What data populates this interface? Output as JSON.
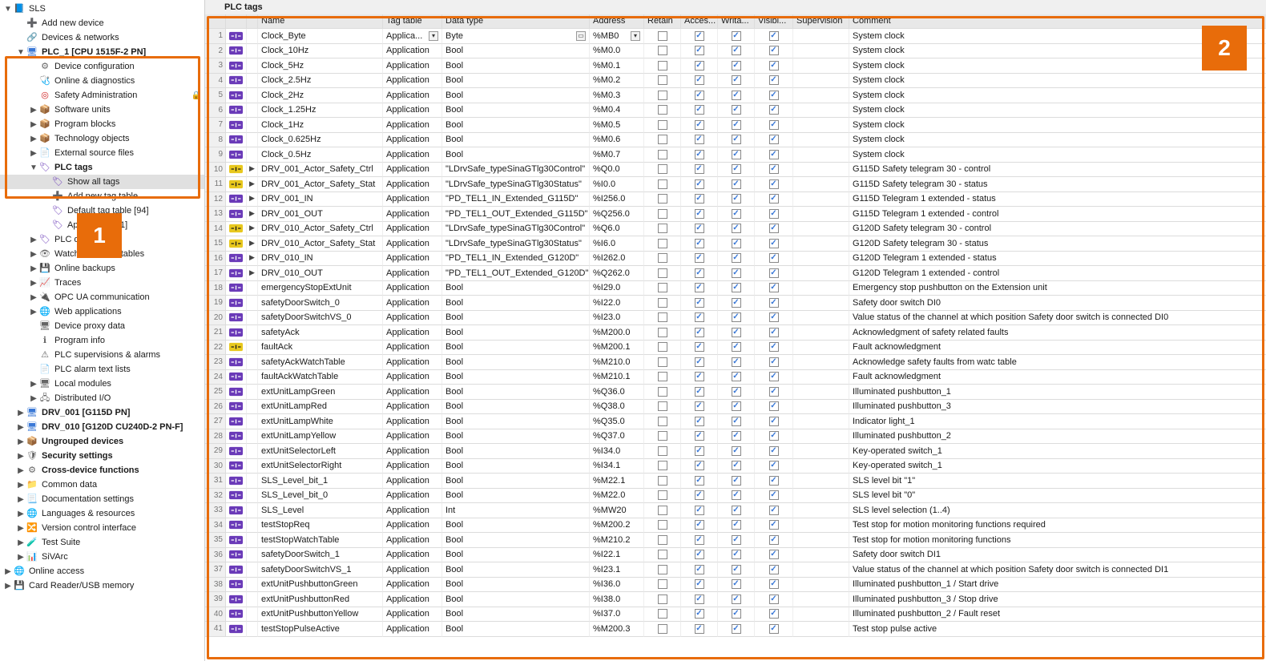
{
  "tab_title": "PLC tags",
  "callouts": {
    "1": "1",
    "2": "2"
  },
  "columns": [
    "",
    "",
    "",
    "Name",
    "Tag table",
    "Data type",
    "Address",
    "Retain",
    "Acces...",
    "Writa...",
    "Visibl...",
    "Supervision",
    "Comment"
  ],
  "tree": [
    {
      "d": 0,
      "tw": "▼",
      "ic": "📘",
      "cls": "i-folderblue",
      "t": "SLS"
    },
    {
      "d": 1,
      "tw": "",
      "ic": "➕",
      "cls": "i-gear",
      "t": "Add new device"
    },
    {
      "d": 1,
      "tw": "",
      "ic": "🔗",
      "cls": "i-gear",
      "t": "Devices & networks"
    },
    {
      "d": 1,
      "tw": "▼",
      "ic": "🖥",
      "cls": "i-cpu",
      "t": "PLC_1 [CPU 1515F-2 PN]",
      "bold": true
    },
    {
      "d": 2,
      "tw": "",
      "ic": "⚙",
      "cls": "i-gear",
      "t": "Device configuration"
    },
    {
      "d": 2,
      "tw": "",
      "ic": "🩺",
      "cls": "i-gear",
      "t": "Online & diagnostics"
    },
    {
      "d": 2,
      "tw": "",
      "ic": "◎",
      "cls": "i-red",
      "t": "Safety Administration",
      "lock": true
    },
    {
      "d": 2,
      "tw": "▶",
      "ic": "📦",
      "cls": "i-folder",
      "t": "Software units"
    },
    {
      "d": 2,
      "tw": "▶",
      "ic": "📦",
      "cls": "i-folder",
      "t": "Program blocks"
    },
    {
      "d": 2,
      "tw": "▶",
      "ic": "📦",
      "cls": "i-folder",
      "t": "Technology objects"
    },
    {
      "d": 2,
      "tw": "▶",
      "ic": "📄",
      "cls": "i-gear",
      "t": "External source files"
    },
    {
      "d": 2,
      "tw": "▼",
      "ic": "🏷",
      "cls": "i-tags",
      "t": "PLC tags",
      "bold": true
    },
    {
      "d": 3,
      "tw": "",
      "ic": "🏷",
      "cls": "i-tags",
      "t": "Show all tags",
      "sel": true
    },
    {
      "d": 3,
      "tw": "",
      "ic": "➕",
      "cls": "i-gear",
      "t": "Add new tag table"
    },
    {
      "d": 3,
      "tw": "",
      "ic": "🏷",
      "cls": "i-tags",
      "t": "Default tag table [94]"
    },
    {
      "d": 3,
      "tw": "",
      "ic": "🏷",
      "cls": "i-tags",
      "t": "Application [41]"
    },
    {
      "d": 2,
      "tw": "▶",
      "ic": "🏷",
      "cls": "i-tags",
      "t": "PLC data types"
    },
    {
      "d": 2,
      "tw": "▶",
      "ic": "👁",
      "cls": "i-gear",
      "t": "Watch and force tables"
    },
    {
      "d": 2,
      "tw": "▶",
      "ic": "💾",
      "cls": "i-gear",
      "t": "Online backups"
    },
    {
      "d": 2,
      "tw": "▶",
      "ic": "📈",
      "cls": "i-gear",
      "t": "Traces"
    },
    {
      "d": 2,
      "tw": "▶",
      "ic": "🔌",
      "cls": "i-gear",
      "t": "OPC UA communication"
    },
    {
      "d": 2,
      "tw": "▶",
      "ic": "🌐",
      "cls": "i-gear",
      "t": "Web applications"
    },
    {
      "d": 2,
      "tw": "",
      "ic": "🖥",
      "cls": "i-gear",
      "t": "Device proxy data"
    },
    {
      "d": 2,
      "tw": "",
      "ic": "ℹ",
      "cls": "i-gear",
      "t": "Program info"
    },
    {
      "d": 2,
      "tw": "",
      "ic": "⚠",
      "cls": "i-gear",
      "t": "PLC supervisions & alarms"
    },
    {
      "d": 2,
      "tw": "",
      "ic": "📄",
      "cls": "i-gear",
      "t": "PLC alarm text lists"
    },
    {
      "d": 2,
      "tw": "▶",
      "ic": "🖥",
      "cls": "i-gear",
      "t": "Local modules"
    },
    {
      "d": 2,
      "tw": "▶",
      "ic": "🖧",
      "cls": "i-gear",
      "t": "Distributed I/O"
    },
    {
      "d": 1,
      "tw": "▶",
      "ic": "🖥",
      "cls": "i-cpu",
      "t": "DRV_001 [G115D PN]",
      "bold": true
    },
    {
      "d": 1,
      "tw": "▶",
      "ic": "🖥",
      "cls": "i-cpu",
      "t": "DRV_010 [G120D CU240D-2 PN-F]",
      "bold": true
    },
    {
      "d": 1,
      "tw": "▶",
      "ic": "📦",
      "cls": "i-folder",
      "t": "Ungrouped devices",
      "bold": true
    },
    {
      "d": 1,
      "tw": "▶",
      "ic": "🛡",
      "cls": "i-gear",
      "t": "Security settings",
      "bold": true
    },
    {
      "d": 1,
      "tw": "▶",
      "ic": "⚙",
      "cls": "i-gear",
      "t": "Cross-device functions",
      "bold": true
    },
    {
      "d": 1,
      "tw": "▶",
      "ic": "📁",
      "cls": "i-folder",
      "t": "Common data"
    },
    {
      "d": 1,
      "tw": "▶",
      "ic": "📃",
      "cls": "i-gear",
      "t": "Documentation settings"
    },
    {
      "d": 1,
      "tw": "▶",
      "ic": "🌐",
      "cls": "i-gear",
      "t": "Languages & resources"
    },
    {
      "d": 1,
      "tw": "▶",
      "ic": "🔀",
      "cls": "i-gear",
      "t": "Version control interface"
    },
    {
      "d": 1,
      "tw": "▶",
      "ic": "🧪",
      "cls": "i-gear",
      "t": "Test Suite"
    },
    {
      "d": 1,
      "tw": "▶",
      "ic": "📊",
      "cls": "i-gear",
      "t": "SiVArc"
    },
    {
      "d": 0,
      "tw": "▶",
      "ic": "🌐",
      "cls": "i-green",
      "t": "Online access"
    },
    {
      "d": 0,
      "tw": "▶",
      "ic": "💾",
      "cls": "i-gear",
      "t": "Card Reader/USB memory"
    }
  ],
  "rows": [
    {
      "n": 1,
      "tag": "p",
      "exp": "",
      "name": "Clock_Byte",
      "tt": "Applica...",
      "dt": "Byte",
      "addr": "%MB0",
      "r": 0,
      "a": 1,
      "w": 1,
      "v": 1,
      "c": "System clock",
      "sel": true,
      "dd": true
    },
    {
      "n": 2,
      "tag": "p",
      "exp": "",
      "name": "Clock_10Hz",
      "tt": "Application",
      "dt": "Bool",
      "addr": "%M0.0",
      "r": 0,
      "a": 1,
      "w": 1,
      "v": 1,
      "c": "System clock"
    },
    {
      "n": 3,
      "tag": "p",
      "exp": "",
      "name": "Clock_5Hz",
      "tt": "Application",
      "dt": "Bool",
      "addr": "%M0.1",
      "r": 0,
      "a": 1,
      "w": 1,
      "v": 1,
      "c": "System clock"
    },
    {
      "n": 4,
      "tag": "p",
      "exp": "",
      "name": "Clock_2.5Hz",
      "tt": "Application",
      "dt": "Bool",
      "addr": "%M0.2",
      "r": 0,
      "a": 1,
      "w": 1,
      "v": 1,
      "c": "System clock"
    },
    {
      "n": 5,
      "tag": "p",
      "exp": "",
      "name": "Clock_2Hz",
      "tt": "Application",
      "dt": "Bool",
      "addr": "%M0.3",
      "r": 0,
      "a": 1,
      "w": 1,
      "v": 1,
      "c": "System clock"
    },
    {
      "n": 6,
      "tag": "p",
      "exp": "",
      "name": "Clock_1.25Hz",
      "tt": "Application",
      "dt": "Bool",
      "addr": "%M0.4",
      "r": 0,
      "a": 1,
      "w": 1,
      "v": 1,
      "c": "System clock"
    },
    {
      "n": 7,
      "tag": "p",
      "exp": "",
      "name": "Clock_1Hz",
      "tt": "Application",
      "dt": "Bool",
      "addr": "%M0.5",
      "r": 0,
      "a": 1,
      "w": 1,
      "v": 1,
      "c": "System clock"
    },
    {
      "n": 8,
      "tag": "p",
      "exp": "",
      "name": "Clock_0.625Hz",
      "tt": "Application",
      "dt": "Bool",
      "addr": "%M0.6",
      "r": 0,
      "a": 1,
      "w": 1,
      "v": 1,
      "c": "System clock"
    },
    {
      "n": 9,
      "tag": "p",
      "exp": "",
      "name": "Clock_0.5Hz",
      "tt": "Application",
      "dt": "Bool",
      "addr": "%M0.7",
      "r": 0,
      "a": 1,
      "w": 1,
      "v": 1,
      "c": "System clock"
    },
    {
      "n": 10,
      "tag": "y",
      "exp": "▶",
      "name": "DRV_001_Actor_Safety_Ctrl",
      "tt": "Application",
      "dt": "\"LDrvSafe_typeSinaGTlg30Control\"",
      "addr": "%Q0.0",
      "r": 0,
      "a": 1,
      "w": 1,
      "v": 1,
      "c": "G115D Safety telegram 30 - control"
    },
    {
      "n": 11,
      "tag": "y",
      "exp": "▶",
      "name": "DRV_001_Actor_Safety_Stat",
      "tt": "Application",
      "dt": "\"LDrvSafe_typeSinaGTlg30Status\"",
      "addr": "%I0.0",
      "r": 0,
      "a": 1,
      "w": 1,
      "v": 1,
      "c": "G115D Safety telegram 30 - status"
    },
    {
      "n": 12,
      "tag": "p",
      "exp": "▶",
      "name": "DRV_001_IN",
      "tt": "Application",
      "dt": "\"PD_TEL1_IN_Extended_G115D\"",
      "addr": "%I256.0",
      "r": 0,
      "a": 1,
      "w": 1,
      "v": 1,
      "c": "G115D Telegram 1 extended - status"
    },
    {
      "n": 13,
      "tag": "p",
      "exp": "▶",
      "name": "DRV_001_OUT",
      "tt": "Application",
      "dt": "\"PD_TEL1_OUT_Extended_G115D\"",
      "addr": "%Q256.0",
      "r": 0,
      "a": 1,
      "w": 1,
      "v": 1,
      "c": "G115D Telegram 1 extended - control"
    },
    {
      "n": 14,
      "tag": "y",
      "exp": "▶",
      "name": "DRV_010_Actor_Safety_Ctrl",
      "tt": "Application",
      "dt": "\"LDrvSafe_typeSinaGTlg30Control\"",
      "addr": "%Q6.0",
      "r": 0,
      "a": 1,
      "w": 1,
      "v": 1,
      "c": "G120D Safety telegram 30 - control"
    },
    {
      "n": 15,
      "tag": "y",
      "exp": "▶",
      "name": "DRV_010_Actor_Safety_Stat",
      "tt": "Application",
      "dt": "\"LDrvSafe_typeSinaGTlg30Status\"",
      "addr": "%I6.0",
      "r": 0,
      "a": 1,
      "w": 1,
      "v": 1,
      "c": "G120D Safety telegram 30 - status"
    },
    {
      "n": 16,
      "tag": "p",
      "exp": "▶",
      "name": "DRV_010_IN",
      "tt": "Application",
      "dt": "\"PD_TEL1_IN_Extended_G120D\"",
      "addr": "%I262.0",
      "r": 0,
      "a": 1,
      "w": 1,
      "v": 1,
      "c": "G120D Telegram 1 extended - status"
    },
    {
      "n": 17,
      "tag": "p",
      "exp": "▶",
      "name": "DRV_010_OUT",
      "tt": "Application",
      "dt": "\"PD_TEL1_OUT_Extended_G120D\"",
      "addr": "%Q262.0",
      "r": 0,
      "a": 1,
      "w": 1,
      "v": 1,
      "c": "G120D Telegram 1 extended - control"
    },
    {
      "n": 18,
      "tag": "p",
      "exp": "",
      "name": "emergencyStopExtUnit",
      "tt": "Application",
      "dt": "Bool",
      "addr": "%I29.0",
      "r": 0,
      "a": 1,
      "w": 1,
      "v": 1,
      "c": "Emergency stop pushbutton on the Extension unit"
    },
    {
      "n": 19,
      "tag": "p",
      "exp": "",
      "name": "safetyDoorSwitch_0",
      "tt": "Application",
      "dt": "Bool",
      "addr": "%I22.0",
      "r": 0,
      "a": 1,
      "w": 1,
      "v": 1,
      "c": "Safety door switch DI0"
    },
    {
      "n": 20,
      "tag": "p",
      "exp": "",
      "name": "safetyDoorSwitchVS_0",
      "tt": "Application",
      "dt": "Bool",
      "addr": "%I23.0",
      "r": 0,
      "a": 1,
      "w": 1,
      "v": 1,
      "c": "Value status of the channel at which position Safety door switch is connected DI0"
    },
    {
      "n": 21,
      "tag": "p",
      "exp": "",
      "name": "safetyAck",
      "tt": "Application",
      "dt": "Bool",
      "addr": "%M200.0",
      "r": 0,
      "a": 1,
      "w": 1,
      "v": 1,
      "c": "Acknowledgment of safety related faults"
    },
    {
      "n": 22,
      "tag": "y",
      "exp": "",
      "name": "faultAck",
      "tt": "Application",
      "dt": "Bool",
      "addr": "%M200.1",
      "r": 0,
      "a": 1,
      "w": 1,
      "v": 1,
      "c": "Fault acknowledgment"
    },
    {
      "n": 23,
      "tag": "p",
      "exp": "",
      "name": "safetyAckWatchTable",
      "tt": "Application",
      "dt": "Bool",
      "addr": "%M210.0",
      "r": 0,
      "a": 1,
      "w": 1,
      "v": 1,
      "c": "Acknowledge safety faults from watc table"
    },
    {
      "n": 24,
      "tag": "p",
      "exp": "",
      "name": "faultAckWatchTable",
      "tt": "Application",
      "dt": "Bool",
      "addr": "%M210.1",
      "r": 0,
      "a": 1,
      "w": 1,
      "v": 1,
      "c": "Fault acknowledgment"
    },
    {
      "n": 25,
      "tag": "p",
      "exp": "",
      "name": "extUnitLampGreen",
      "tt": "Application",
      "dt": "Bool",
      "addr": "%Q36.0",
      "r": 0,
      "a": 1,
      "w": 1,
      "v": 1,
      "c": "Illuminated pushbutton_1"
    },
    {
      "n": 26,
      "tag": "p",
      "exp": "",
      "name": "extUnitLampRed",
      "tt": "Application",
      "dt": "Bool",
      "addr": "%Q38.0",
      "r": 0,
      "a": 1,
      "w": 1,
      "v": 1,
      "c": "Illuminated pushbutton_3"
    },
    {
      "n": 27,
      "tag": "p",
      "exp": "",
      "name": "extUnitLampWhite",
      "tt": "Application",
      "dt": "Bool",
      "addr": "%Q35.0",
      "r": 0,
      "a": 1,
      "w": 1,
      "v": 1,
      "c": "Indicator light_1"
    },
    {
      "n": 28,
      "tag": "p",
      "exp": "",
      "name": "extUnitLampYellow",
      "tt": "Application",
      "dt": "Bool",
      "addr": "%Q37.0",
      "r": 0,
      "a": 1,
      "w": 1,
      "v": 1,
      "c": "Illuminated pushbutton_2"
    },
    {
      "n": 29,
      "tag": "p",
      "exp": "",
      "name": "extUnitSelectorLeft",
      "tt": "Application",
      "dt": "Bool",
      "addr": "%I34.0",
      "r": 0,
      "a": 1,
      "w": 1,
      "v": 1,
      "c": "Key-operated switch_1"
    },
    {
      "n": 30,
      "tag": "p",
      "exp": "",
      "name": "extUnitSelectorRight",
      "tt": "Application",
      "dt": "Bool",
      "addr": "%I34.1",
      "r": 0,
      "a": 1,
      "w": 1,
      "v": 1,
      "c": "Key-operated switch_1"
    },
    {
      "n": 31,
      "tag": "p",
      "exp": "",
      "name": "SLS_Level_bit_1",
      "tt": "Application",
      "dt": "Bool",
      "addr": "%M22.1",
      "r": 0,
      "a": 1,
      "w": 1,
      "v": 1,
      "c": "SLS level bit \"1\""
    },
    {
      "n": 32,
      "tag": "p",
      "exp": "",
      "name": "SLS_Level_bit_0",
      "tt": "Application",
      "dt": "Bool",
      "addr": "%M22.0",
      "r": 0,
      "a": 1,
      "w": 1,
      "v": 1,
      "c": "SLS level bit \"0\""
    },
    {
      "n": 33,
      "tag": "p",
      "exp": "",
      "name": "SLS_Level",
      "tt": "Application",
      "dt": "Int",
      "addr": "%MW20",
      "r": 0,
      "a": 1,
      "w": 1,
      "v": 1,
      "c": "SLS level selection (1..4)"
    },
    {
      "n": 34,
      "tag": "p",
      "exp": "",
      "name": "testStopReq",
      "tt": "Application",
      "dt": "Bool",
      "addr": "%M200.2",
      "r": 0,
      "a": 1,
      "w": 1,
      "v": 1,
      "c": "Test stop for motion monitoring functions required"
    },
    {
      "n": 35,
      "tag": "p",
      "exp": "",
      "name": "testStopWatchTable",
      "tt": "Application",
      "dt": "Bool",
      "addr": "%M210.2",
      "r": 0,
      "a": 1,
      "w": 1,
      "v": 1,
      "c": "Test stop for motion monitoring functions"
    },
    {
      "n": 36,
      "tag": "p",
      "exp": "",
      "name": "safetyDoorSwitch_1",
      "tt": "Application",
      "dt": "Bool",
      "addr": "%I22.1",
      "r": 0,
      "a": 1,
      "w": 1,
      "v": 1,
      "c": "Safety door switch DI1"
    },
    {
      "n": 37,
      "tag": "p",
      "exp": "",
      "name": "safetyDoorSwitchVS_1",
      "tt": "Application",
      "dt": "Bool",
      "addr": "%I23.1",
      "r": 0,
      "a": 1,
      "w": 1,
      "v": 1,
      "c": "Value status of the channel at which position Safety door switch is connected DI1"
    },
    {
      "n": 38,
      "tag": "p",
      "exp": "",
      "name": "extUnitPushbuttonGreen",
      "tt": "Application",
      "dt": "Bool",
      "addr": "%I36.0",
      "r": 0,
      "a": 1,
      "w": 1,
      "v": 1,
      "c": "Illuminated pushbutton_1 / Start drive"
    },
    {
      "n": 39,
      "tag": "p",
      "exp": "",
      "name": "extUnitPushbuttonRed",
      "tt": "Application",
      "dt": "Bool",
      "addr": "%I38.0",
      "r": 0,
      "a": 1,
      "w": 1,
      "v": 1,
      "c": "Illuminated pushbutton_3 / Stop drive"
    },
    {
      "n": 40,
      "tag": "p",
      "exp": "",
      "name": "extUnitPushbuttonYellow",
      "tt": "Application",
      "dt": "Bool",
      "addr": "%I37.0",
      "r": 0,
      "a": 1,
      "w": 1,
      "v": 1,
      "c": "Illuminated pushbutton_2 / Fault reset"
    },
    {
      "n": 41,
      "tag": "p",
      "exp": "",
      "name": "testStopPulseActive",
      "tt": "Application",
      "dt": "Bool",
      "addr": "%M200.3",
      "r": 0,
      "a": 1,
      "w": 1,
      "v": 1,
      "c": "Test stop pulse active"
    }
  ]
}
